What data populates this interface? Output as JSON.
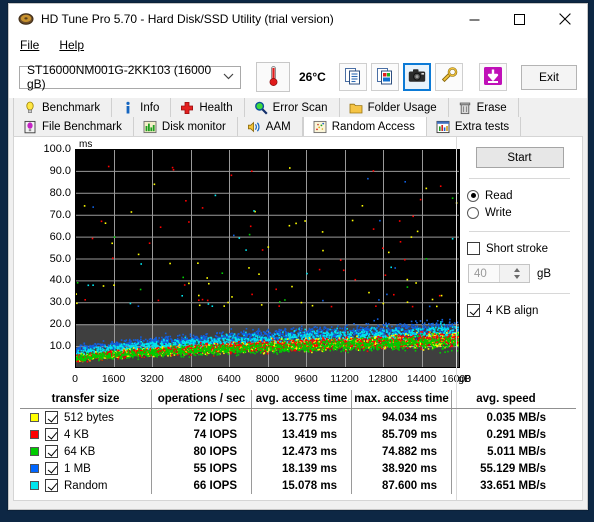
{
  "window": {
    "title": "HD Tune Pro 5.70 - Hard Disk/SSD Utility (trial version)",
    "icon": "harddisk-icon",
    "minimize_label": "—",
    "maximize_label": "□",
    "close_label": "✕"
  },
  "menu": {
    "items": [
      {
        "label": "File",
        "mnemonic": "F"
      },
      {
        "label": "Help",
        "mnemonic": "H"
      }
    ]
  },
  "toolbar": {
    "drive": "ST16000NM001G-2KK103 (16000 gB)",
    "drive_chevron": "⌄",
    "temperature": "26°C",
    "buttons": [
      {
        "name": "copy-text-button",
        "icon": "copy-text-icon"
      },
      {
        "name": "copy-image-button",
        "icon": "copy-image-icon"
      },
      {
        "name": "screenshot-button",
        "icon": "camera-icon",
        "selected": true
      },
      {
        "name": "options-button",
        "icon": "tools-icon"
      },
      {
        "name": "save-button",
        "icon": "download-arrow-icon"
      }
    ],
    "exit_label": "Exit"
  },
  "tabs": {
    "row1": [
      {
        "label": "Benchmark",
        "icon": "lightbulb-icon",
        "active": false
      },
      {
        "label": "Info",
        "icon": "info-icon",
        "active": false
      },
      {
        "label": "Health",
        "icon": "redcross-icon",
        "active": false
      },
      {
        "label": "Error Scan",
        "icon": "magnifier-icon",
        "active": false
      },
      {
        "label": "Folder Usage",
        "icon": "folder-icon",
        "active": false
      },
      {
        "label": "Erase",
        "icon": "trash-icon",
        "active": false
      }
    ],
    "row2": [
      {
        "label": "File Benchmark",
        "icon": "file-benchmark-icon",
        "active": false
      },
      {
        "label": "Disk monitor",
        "icon": "bargraph-icon",
        "active": false
      },
      {
        "label": "AAM",
        "icon": "speaker-icon",
        "active": false
      },
      {
        "label": "Random Access",
        "icon": "scatter-icon",
        "active": true
      },
      {
        "label": "Extra tests",
        "icon": "chart-icon",
        "active": false
      }
    ]
  },
  "controls": {
    "start_label": "Start",
    "mode": {
      "read_label": "Read",
      "write_label": "Write",
      "selected": "Read"
    },
    "short_stroke": {
      "label": "Short stroke",
      "checked": false,
      "value": "40",
      "unit": "gB"
    },
    "align": {
      "label": "4 KB align",
      "checked": true
    }
  },
  "chart_data": {
    "type": "scatter",
    "title": "",
    "xlabel": "gB",
    "ylabel": "ms",
    "y_unit": "ms",
    "x_unit": "gB",
    "xlim": [
      0,
      16000
    ],
    "ylim": [
      0,
      100
    ],
    "grid": true,
    "background": "#000000",
    "band_color": "#3f3f3f",
    "band_threshold_ms": 20,
    "gridline_color": "#9a9a9a",
    "yticks": [
      "100.0",
      "90.0",
      "80.0",
      "70.0",
      "60.0",
      "50.0",
      "40.0",
      "30.0",
      "20.0",
      "10.0"
    ],
    "ytick_values": [
      100,
      90,
      80,
      70,
      60,
      50,
      40,
      30,
      20,
      10
    ],
    "xticks": [
      "0",
      "1600",
      "3200",
      "4800",
      "6400",
      "8000",
      "9600",
      "11200",
      "12800",
      "14400",
      "16000"
    ],
    "xtick_values": [
      0,
      1600,
      3200,
      4800,
      6400,
      8000,
      9600,
      11200,
      12800,
      14400,
      16000
    ],
    "series": [
      {
        "name": "512 bytes",
        "color": "#ffff00",
        "point_count": 1400,
        "band_center_ms": [
          4,
          13
        ],
        "spread_ms": 4
      },
      {
        "name": "4 KB",
        "color": "#ff0000",
        "point_count": 1400,
        "band_center_ms": [
          4,
          13
        ],
        "spread_ms": 4
      },
      {
        "name": "64 KB",
        "color": "#00cc00",
        "point_count": 1400,
        "band_center_ms": [
          4,
          12
        ],
        "spread_ms": 4
      },
      {
        "name": "1 MB",
        "color": "#1060e0",
        "point_count": 1400,
        "band_center_ms": [
          8,
          18
        ],
        "spread_ms": 5
      },
      {
        "name": "Random",
        "color": "#00e5ee",
        "point_count": 1400,
        "band_center_ms": [
          6,
          16
        ],
        "spread_ms": 5
      }
    ],
    "outlier_note": "sparse outliers between 30 ms and 92 ms, mostly yellow and red"
  },
  "results": {
    "headers": [
      "transfer size",
      "operations / sec",
      "avg. access time",
      "max. access time",
      "avg. speed"
    ],
    "rows": [
      {
        "color": "#ffff00",
        "checked": true,
        "name": "512 bytes",
        "iops": "72 IOPS",
        "avg_access": "13.775 ms",
        "max_access": "94.034 ms",
        "avg_speed": "0.035 MB/s"
      },
      {
        "color": "#ff0000",
        "checked": true,
        "name": "4 KB",
        "iops": "74 IOPS",
        "avg_access": "13.419 ms",
        "max_access": "85.709 ms",
        "avg_speed": "0.291 MB/s"
      },
      {
        "color": "#00cc00",
        "checked": true,
        "name": "64 KB",
        "iops": "80 IOPS",
        "avg_access": "12.473 ms",
        "max_access": "74.882 ms",
        "avg_speed": "5.011 MB/s"
      },
      {
        "color": "#0066ff",
        "checked": true,
        "name": "1 MB",
        "iops": "55 IOPS",
        "avg_access": "18.139 ms",
        "max_access": "38.920 ms",
        "avg_speed": "55.129 MB/s"
      },
      {
        "color": "#00e5ee",
        "checked": true,
        "name": "Random",
        "iops": "66 IOPS",
        "avg_access": "15.078 ms",
        "max_access": "87.600 ms",
        "avg_speed": "33.651 MB/s"
      }
    ]
  }
}
